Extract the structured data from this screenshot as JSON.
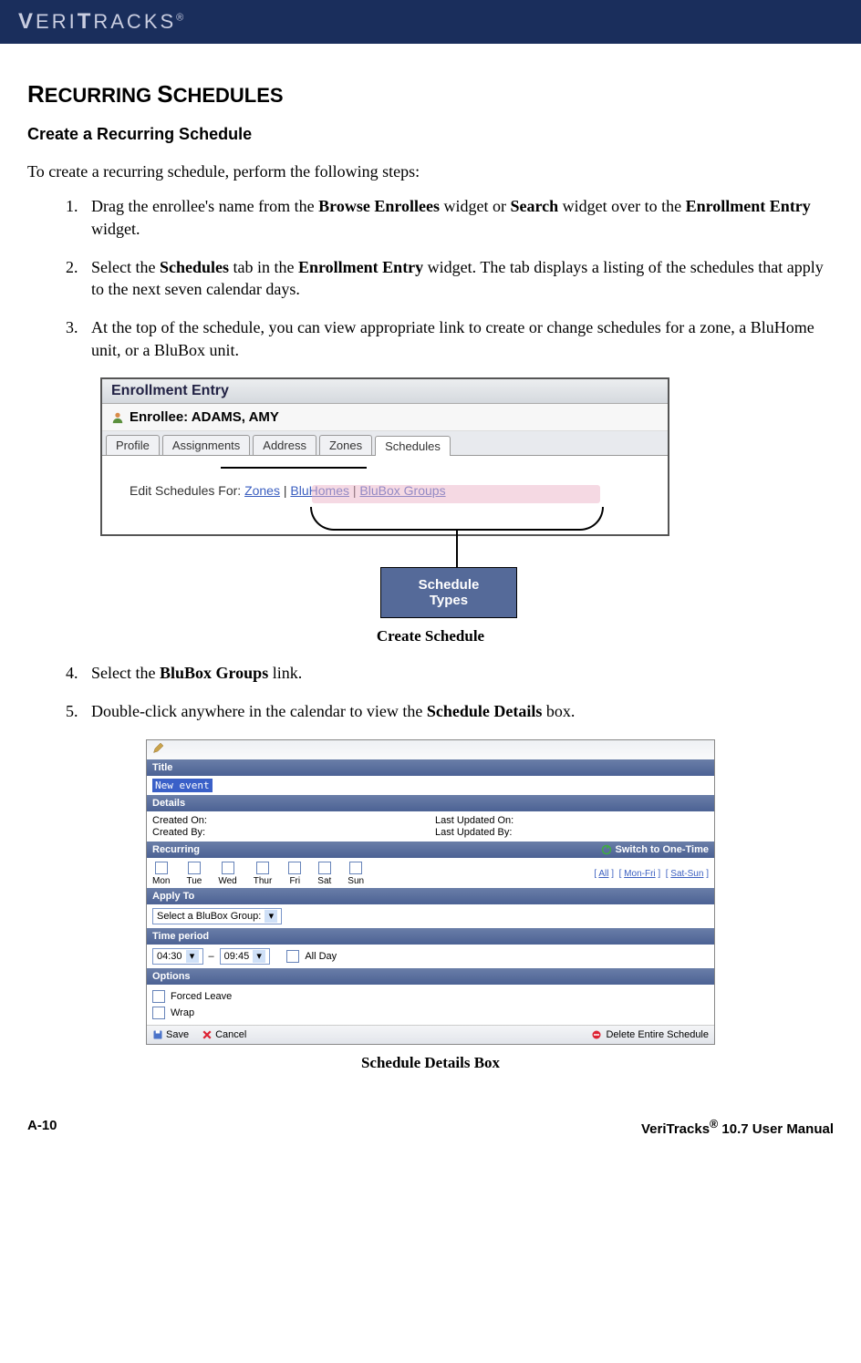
{
  "banner": {
    "brand": "VERITRACKS",
    "reg": "®"
  },
  "h1": "RECURRING SCHEDULES",
  "h2": "Create a Recurring Schedule",
  "intro": "To create a recurring schedule, perform the following steps:",
  "steps": {
    "1a": "Drag the enrollee's name from the ",
    "1b": "Browse Enrollees",
    "1c": " widget or ",
    "1d": "Search",
    "1e": " widget over to the ",
    "1f": "Enrollment Entry",
    "1g": " widget.",
    "2a": "Select the ",
    "2b": "Schedules",
    "2c": " tab in the ",
    "2d": "Enrollment Entry",
    "2e": " widget. The tab displays a listing of the schedules that apply to the next seven calendar days.",
    "3": "At the top of the schedule, you can view appropriate link to create or change schedules for a zone, a BluHome unit, or a BluBox unit.",
    "4a": "Select the ",
    "4b": "BluBox Groups",
    "4c": " link.",
    "5a": "Double-click anywhere in the calendar to view the ",
    "5b": "Schedule Details",
    "5c": " box."
  },
  "fig1": {
    "window_title": "Enrollment Entry",
    "enrollee_label": "Enrollee: ADAMS, AMY",
    "tabs": [
      "Profile",
      "Assignments",
      "Address",
      "Zones",
      "Schedules"
    ],
    "edit_label": "Edit Schedules For:",
    "links": [
      "Zones",
      "BluHomes",
      "BluBox Groups"
    ],
    "callout_label": "Schedule Types",
    "caption": "Create Schedule"
  },
  "fig2": {
    "title_header": "Title",
    "title_value": "New event",
    "details_header": "Details",
    "created_on": "Created On:",
    "created_by": "Created By:",
    "last_updated_on": "Last Updated On:",
    "last_updated_by": "Last Updated By:",
    "recurring_header": "Recurring",
    "switch_label": "Switch to One-Time",
    "days": [
      "Mon",
      "Tue",
      "Wed",
      "Thur",
      "Fri",
      "Sat",
      "Sun"
    ],
    "quick_all": "All",
    "quick_monfri": "Mon-Fri",
    "quick_satsun": "Sat-Sun",
    "applyto_header": "Apply To",
    "applyto_select": "Select a BluBox Group:",
    "timeperiod_header": "Time period",
    "time_from": "04:30",
    "time_to": "09:45",
    "all_day": "All Day",
    "options_header": "Options",
    "opt_forced": "Forced Leave",
    "opt_wrap": "Wrap",
    "save": "Save",
    "cancel": "Cancel",
    "delete": "Delete Entire Schedule",
    "caption": "Schedule Details Box"
  },
  "footer": {
    "left": "A-10",
    "right_product": "VeriTracks",
    "right_reg": "®",
    "right_rest": " 10.7 User Manual"
  }
}
